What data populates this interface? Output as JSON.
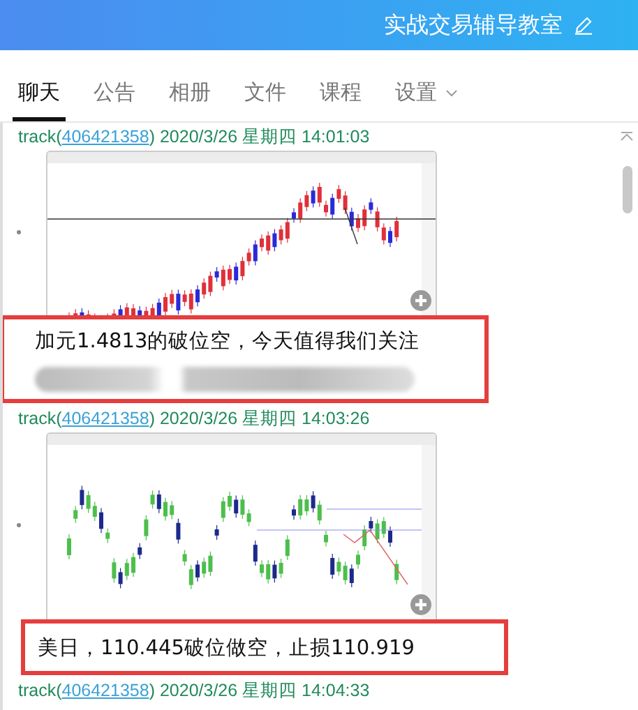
{
  "header": {
    "title": "实战交易辅导教室"
  },
  "tabs": [
    {
      "label": "聊天",
      "selected": true,
      "dropdown": false
    },
    {
      "label": "公告",
      "selected": false,
      "dropdown": false
    },
    {
      "label": "相册",
      "selected": false,
      "dropdown": false
    },
    {
      "label": "文件",
      "selected": false,
      "dropdown": false
    },
    {
      "label": "课程",
      "selected": false,
      "dropdown": false
    },
    {
      "label": "设置",
      "selected": false,
      "dropdown": true
    }
  ],
  "messages": [
    {
      "sender": "track(",
      "sender_id": "406421358",
      "meta": ") 2020/3/26 星期四 14:01:03",
      "kind": "uptrend",
      "caption": "加元1.4813的破位空，今天值得我们关注",
      "redacted_line": true
    },
    {
      "sender": "track(",
      "sender_id": "406421358",
      "meta": ") 2020/3/26 星期四 14:03:26",
      "kind": "range",
      "caption": "美日，110.445破位做空，止损110.919",
      "redacted_line": false
    },
    {
      "sender": "track(",
      "sender_id": "406421358",
      "meta": ") 2020/3/26 星期四 14:04:33"
    }
  ]
}
